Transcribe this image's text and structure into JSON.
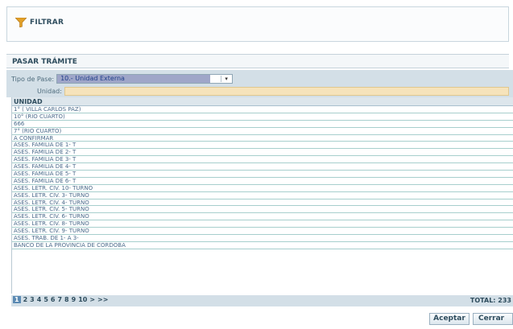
{
  "filter": {
    "label": "FILTRAR",
    "icon": "funnel-icon"
  },
  "section": {
    "title": "PASAR TRÁMITE"
  },
  "form": {
    "tipo_label": "Tipo de Pase:",
    "tipo_value": "10.- Unidad Externa",
    "unidad_label": "Unidad:",
    "unidad_value": ""
  },
  "grid": {
    "header": "UNIDAD",
    "rows": [
      "1° ( VILLA CARLOS PAZ)",
      "10° (RIO CUARTO)",
      "666",
      "7° (RIO CUARTO)",
      "A CONFIRMAR",
      "ASES. FAMILIA DE 1- T",
      "ASES. FAMILIA DE 2- T",
      "ASES. FAMILIA DE 3- T",
      "ASES. FAMILIA DE 4- T",
      "ASES. FAMILIA DE 5- T",
      "ASES. FAMILIA DE 6- T",
      "ASES. LETR. CIV. 10- TURNO",
      "ASES. LETR. CIV. 3- TURNO",
      "ASES. LETR. CIV. 4- TURNO",
      "ASES. LETR. CIV. 5- TURNO",
      "ASES. LETR. CIV. 6- TURNO",
      "ASES. LETR. CIV. 8- TURNO",
      "ASES. LETR. CIV. 9- TURNO",
      "ASES. TRAB. DE 1- A 3-",
      "BANCO DE LA PROVINCIA DE CORDOBA"
    ]
  },
  "pager": {
    "pages": [
      "1",
      "2",
      "3",
      "4",
      "5",
      "6",
      "7",
      "8",
      "9",
      "10",
      ">",
      ">>"
    ],
    "current": "1",
    "total": "TOTAL: 233"
  },
  "buttons": {
    "accept": "Aceptar",
    "close": "Cerrar"
  }
}
